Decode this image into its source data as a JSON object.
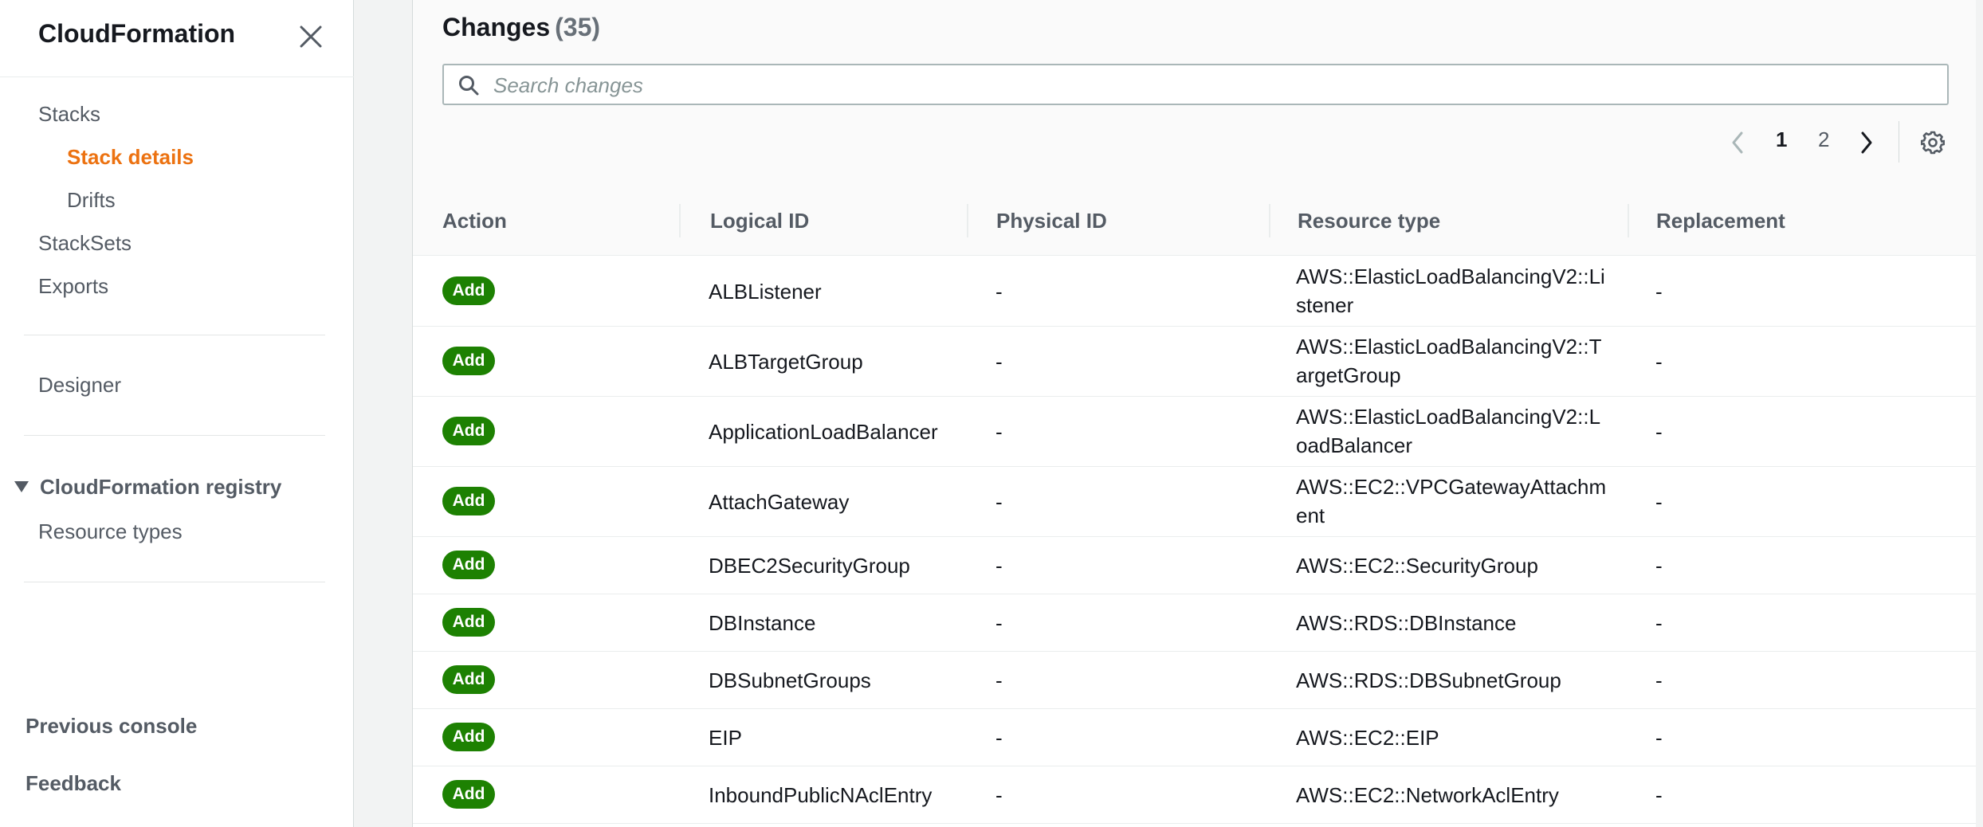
{
  "sidebar": {
    "title": "CloudFormation",
    "items": [
      {
        "label": "Stacks"
      },
      {
        "label": "Stack details"
      },
      {
        "label": "Drifts"
      },
      {
        "label": "StackSets"
      },
      {
        "label": "Exports"
      },
      {
        "label": "Designer"
      }
    ],
    "registry_section": "CloudFormation registry",
    "registry_items": [
      {
        "label": "Resource types"
      }
    ],
    "bottom_links": [
      {
        "label": "Previous console"
      },
      {
        "label": "Feedback"
      }
    ]
  },
  "changes": {
    "title": "Changes",
    "count": "(35)",
    "search_placeholder": "Search changes",
    "pagination": {
      "current": "1",
      "next": "2"
    },
    "columns": [
      "Action",
      "Logical ID",
      "Physical ID",
      "Resource type",
      "Replacement"
    ],
    "rows": [
      {
        "action": "Add",
        "logical_id": "ALBListener",
        "physical_id": "-",
        "resource_type": "AWS::ElasticLoadBalancingV2::Listener",
        "replacement": "-"
      },
      {
        "action": "Add",
        "logical_id": "ALBTargetGroup",
        "physical_id": "-",
        "resource_type": "AWS::ElasticLoadBalancingV2::TargetGroup",
        "replacement": "-"
      },
      {
        "action": "Add",
        "logical_id": "ApplicationLoadBalancer",
        "physical_id": "-",
        "resource_type": "AWS::ElasticLoadBalancingV2::LoadBalancer",
        "replacement": "-"
      },
      {
        "action": "Add",
        "logical_id": "AttachGateway",
        "physical_id": "-",
        "resource_type": "AWS::EC2::VPCGatewayAttachment",
        "replacement": "-"
      },
      {
        "action": "Add",
        "logical_id": "DBEC2SecurityGroup",
        "physical_id": "-",
        "resource_type": "AWS::EC2::SecurityGroup",
        "replacement": "-"
      },
      {
        "action": "Add",
        "logical_id": "DBInstance",
        "physical_id": "-",
        "resource_type": "AWS::RDS::DBInstance",
        "replacement": "-"
      },
      {
        "action": "Add",
        "logical_id": "DBSubnetGroups",
        "physical_id": "-",
        "resource_type": "AWS::RDS::DBSubnetGroup",
        "replacement": "-"
      },
      {
        "action": "Add",
        "logical_id": "EIP",
        "physical_id": "-",
        "resource_type": "AWS::EC2::EIP",
        "replacement": "-"
      },
      {
        "action": "Add",
        "logical_id": "InboundPublicNAclEntry",
        "physical_id": "-",
        "resource_type": "AWS::EC2::NetworkAclEntry",
        "replacement": "-"
      }
    ]
  },
  "colors": {
    "accent": "#ec7211",
    "badge_add": "#1d8102",
    "text": "#16191f",
    "muted": "#545b64"
  },
  "icons": [
    "close-icon",
    "search-icon",
    "chevron-left-icon",
    "chevron-right-icon",
    "gear-icon",
    "caret-down-icon"
  ]
}
